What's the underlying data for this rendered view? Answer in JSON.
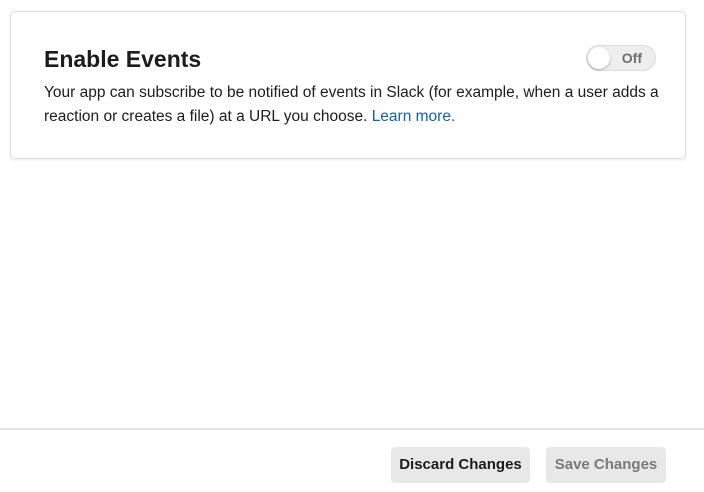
{
  "events": {
    "title": "Enable Events",
    "description": "Your app can subscribe to be notified of events in Slack (for example, when a user adds a reaction or creates a file) at a URL you choose.",
    "learn_more": "Learn more.",
    "toggle": {
      "label": "Off",
      "enabled": false
    }
  },
  "footer": {
    "discard_label": "Discard Changes",
    "save_label": "Save Changes"
  },
  "colors": {
    "link": "#1264a3",
    "text": "#1d1c1d",
    "button_bg": "#e8e8e8",
    "disabled_text": "#7a7a7a"
  }
}
